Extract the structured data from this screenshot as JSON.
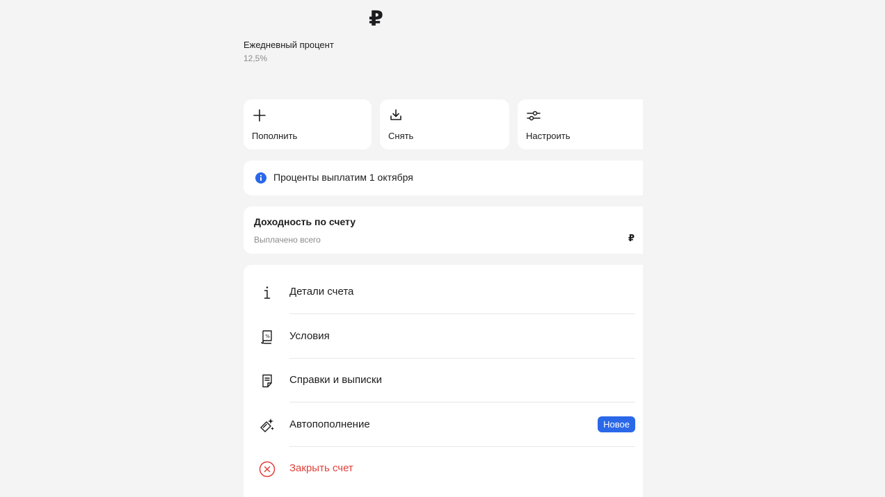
{
  "balance": {
    "currency": "₽"
  },
  "rate": {
    "label": "Ежедневный процент",
    "value": "12,5%"
  },
  "actions": [
    {
      "label": "Пополнить",
      "icon": "plus-icon"
    },
    {
      "label": "Снять",
      "icon": "download-icon"
    },
    {
      "label": "Настроить",
      "icon": "settings-sliders-icon"
    }
  ],
  "notice": {
    "icon": "info-icon",
    "text": "Проценты выплатим 1 октября",
    "icon_color": "#2a68e8"
  },
  "yield": {
    "title": "Доходность по счету",
    "subtitle": "Выплачено всего",
    "amount": "₽"
  },
  "menu": [
    {
      "label": "Детали счета",
      "icon": "info-letter-icon"
    },
    {
      "label": "Условия",
      "icon": "terms-percent-icon"
    },
    {
      "label": "Справки и выписки",
      "icon": "document-icon"
    },
    {
      "label": "Автопополнение",
      "icon": "auto-topup-icon",
      "badge": "Новое"
    },
    {
      "label": "Закрыть счет",
      "icon": "close-circle-icon",
      "color": "#e0413a"
    }
  ],
  "colors": {
    "accent": "#2a68e8",
    "danger": "#e0413a",
    "background": "#f4f4f4"
  }
}
